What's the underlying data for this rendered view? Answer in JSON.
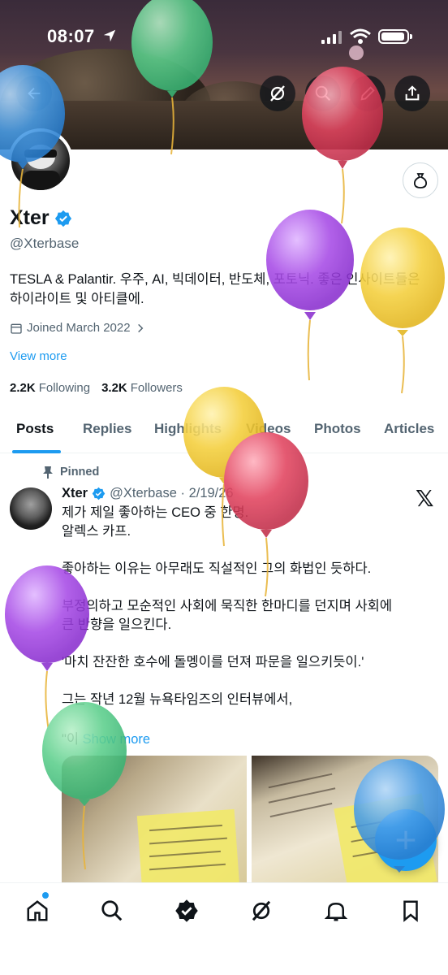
{
  "status": {
    "time": "08:07"
  },
  "profile": {
    "name": "Xter",
    "handle": "@Xterbase",
    "bio_line1": "TESLA & Palantir. 우주, AI, 빅데이터, 반도체, 포토닉. 좋은 인사이트들은",
    "bio_line2": "하이라이트 및 아티클에.",
    "joined": "Joined March 2022",
    "view_more": "View more",
    "following_count": "2.2K",
    "following_label": "Following",
    "followers_count": "3.2K",
    "followers_label": "Followers"
  },
  "tabs": [
    "Posts",
    "Replies",
    "Highlights",
    "Videos",
    "Photos",
    "Articles"
  ],
  "post": {
    "pinned_label": "Pinned",
    "author": "Xter",
    "handle_date": "@Xterbase · 2/19/26",
    "lines": [
      "제가 제일 좋아하는 CEO 중 한명.",
      "알렉스 카프.",
      "",
      "좋아하는 이유는 아무래도 직설적인 그의 화법인 듯하다.",
      "",
      "부정의하고 모순적인 사회에 묵직한 한마디를 던지며 사회에",
      "큰 반향을 일으킨다.",
      "",
      "'마치 잔잔한 호수에 돌멩이를 던져 파문을 일으키듯이.'",
      "",
      "그는 작년 12월 뉴욕타임즈의 인터뷰에서,"
    ],
    "quote_start": "\"이",
    "show_more": "Show more"
  },
  "icons": {
    "back": "back-arrow-icon",
    "grok": "grok-icon",
    "search": "search-icon",
    "edit": "pencil-icon",
    "share": "share-icon",
    "bell": "money-bag-icon",
    "verified": "verified-badge-icon",
    "compose": "plus-icon"
  },
  "colors": {
    "accent": "#1d9bf0",
    "text": "#0f1419",
    "muted": "#536471"
  }
}
